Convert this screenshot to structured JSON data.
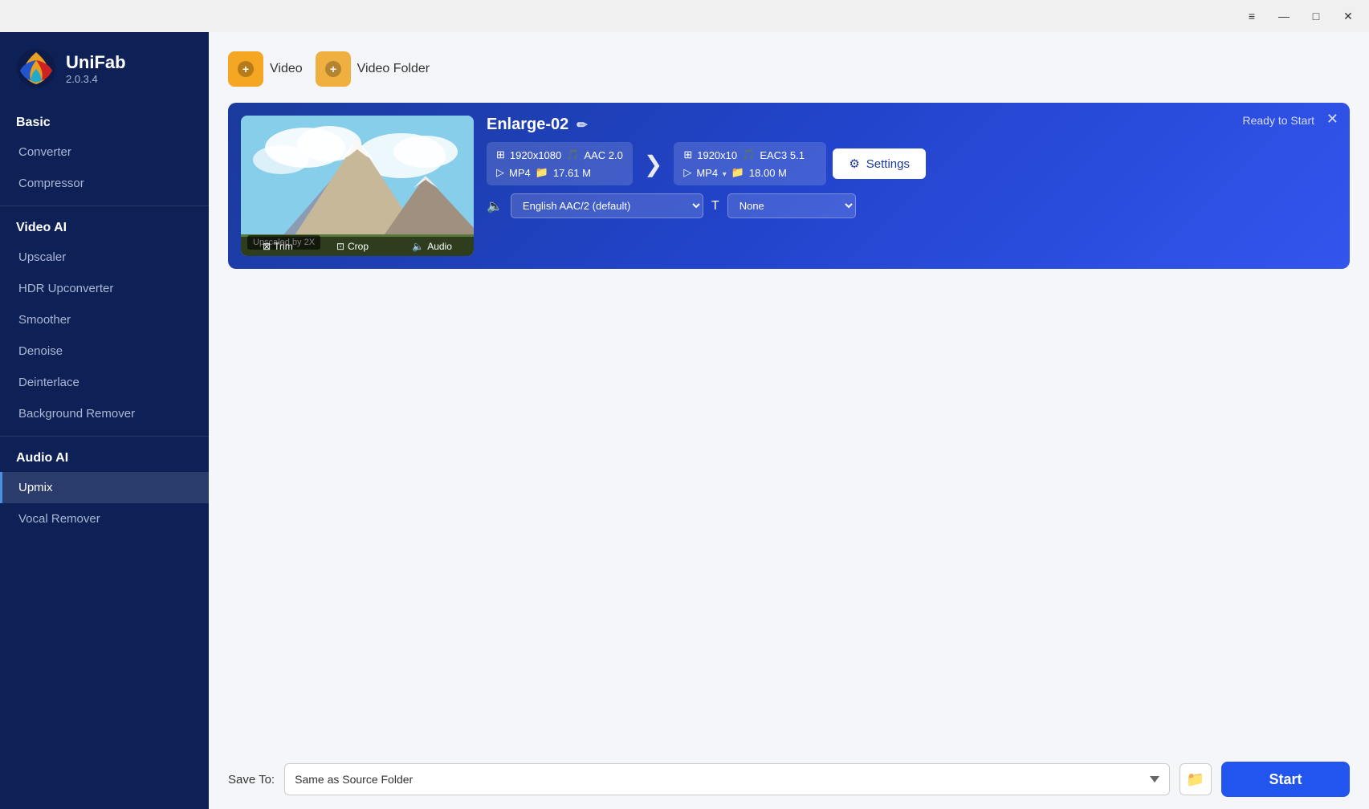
{
  "titlebar": {
    "menu_icon": "≡",
    "minimize_icon": "—",
    "maximize_icon": "□",
    "close_icon": "✕"
  },
  "app": {
    "name": "UniFab",
    "version": "2.0.3.4"
  },
  "sidebar": {
    "sections": [
      {
        "label": "Basic",
        "items": [
          {
            "id": "converter",
            "label": "Converter",
            "active": false
          },
          {
            "id": "compressor",
            "label": "Compressor",
            "active": false
          }
        ]
      },
      {
        "label": "Video AI",
        "items": [
          {
            "id": "upscaler",
            "label": "Upscaler",
            "active": false
          },
          {
            "id": "hdr-upconverter",
            "label": "HDR Upconverter",
            "active": false
          },
          {
            "id": "smoother",
            "label": "Smoother",
            "active": false
          },
          {
            "id": "denoise",
            "label": "Denoise",
            "active": false
          },
          {
            "id": "deinterlace",
            "label": "Deinterlace",
            "active": false
          },
          {
            "id": "background-remover",
            "label": "Background Remover",
            "active": false
          }
        ]
      },
      {
        "label": "Audio AI",
        "items": [
          {
            "id": "upmix",
            "label": "Upmix",
            "active": true
          },
          {
            "id": "vocal-remover",
            "label": "Vocal Remover",
            "active": false
          }
        ]
      }
    ]
  },
  "toolbar": {
    "add_video_label": "Video",
    "add_folder_label": "Video Folder"
  },
  "video_card": {
    "title": "Enlarge-02",
    "ready_label": "Ready to Start",
    "source": {
      "resolution": "1920x1080",
      "audio": "AAC 2.0",
      "format": "MP4",
      "size": "17.61 M"
    },
    "output": {
      "resolution": "1920x10",
      "audio": "EAC3 5.1",
      "format": "MP4",
      "size": "18.00 M"
    },
    "audio_track": "English AAC/2 (default)",
    "subtitle": "None",
    "settings_label": "Settings",
    "trim_label": "Trim",
    "crop_label": "Crop",
    "audio_label": "Audio",
    "upscale_label": "Upscaled by 2X"
  },
  "bottom_bar": {
    "save_to_label": "Save To:",
    "save_to_value": "Same as Source Folder",
    "start_label": "Start"
  }
}
